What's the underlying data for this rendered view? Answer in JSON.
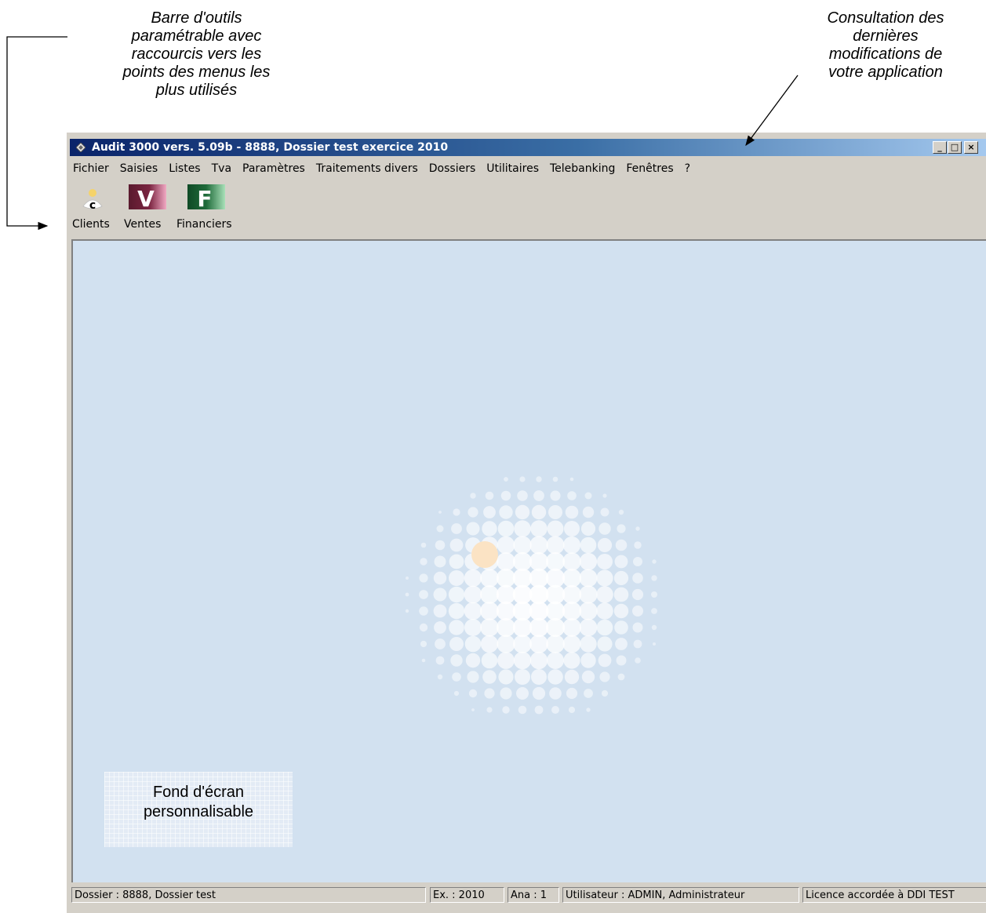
{
  "annotations": {
    "toolbar_note_lines": [
      "Barre d'outils",
      "paramétrable avec",
      "raccourcis vers les",
      "points des menus les",
      "plus utilisés"
    ],
    "changes_note_lines": [
      "Consultation des",
      "dernières",
      "modifications de",
      "votre application"
    ],
    "wallpaper_note_lines": [
      "Fond d'écran",
      "personnalisable"
    ]
  },
  "window": {
    "title": "Audit 3000 vers. 5.09b - 8888, Dossier test exercice 2010",
    "buttons": {
      "minimize": "_",
      "maximize": "□",
      "close": "×"
    }
  },
  "menu": [
    "Fichier",
    "Saisies",
    "Listes",
    "Tva",
    "Paramètres",
    "Traitements divers",
    "Dossiers",
    "Utilitaires",
    "Telebanking",
    "Fenêtres",
    "?"
  ],
  "toolbar": {
    "clients": {
      "label": "Clients",
      "icon": "clients-icon",
      "glyph": "c"
    },
    "ventes": {
      "label": "Ventes",
      "icon": "ventes-icon",
      "glyph": "V"
    },
    "financiers": {
      "label": "Financiers",
      "icon": "financiers-icon",
      "glyph": "F"
    }
  },
  "status": {
    "dossier": "Dossier : 8888, Dossier test",
    "exercice": "Ex. : 2010",
    "ana": "Ana : 1",
    "user": "Utilisateur : ADMIN, Administrateur",
    "licence": "Licence accordée à DDI TEST"
  },
  "colors": {
    "title_gradient_start": "#0a246a",
    "title_gradient_end": "#a6caf0",
    "desktop_bg": "#d2e1f0",
    "chrome": "#d4d0c8",
    "ventes_tile": "#7a2440",
    "financiers_tile": "#1f6b3a",
    "highlight_dot": "#fbe3c4"
  }
}
